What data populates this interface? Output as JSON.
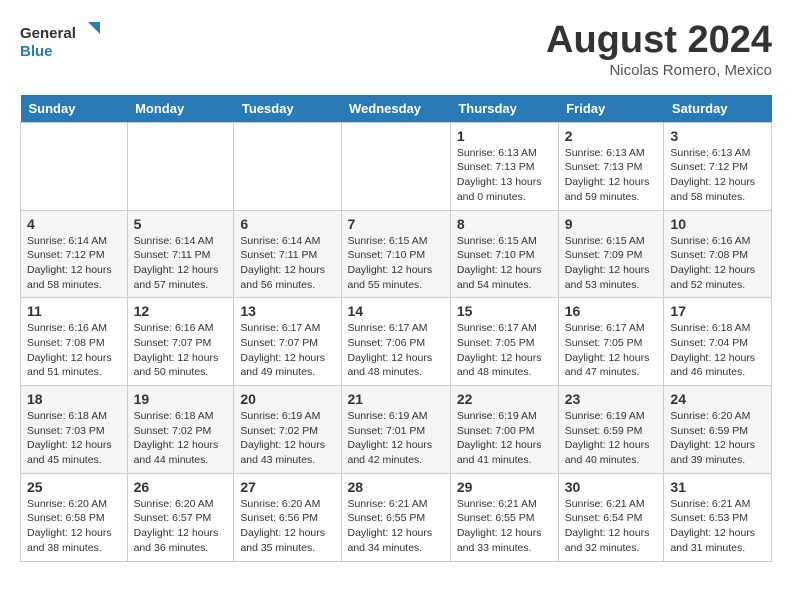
{
  "header": {
    "logo_line1": "General",
    "logo_line2": "Blue",
    "month": "August 2024",
    "location": "Nicolas Romero, Mexico"
  },
  "weekdays": [
    "Sunday",
    "Monday",
    "Tuesday",
    "Wednesday",
    "Thursday",
    "Friday",
    "Saturday"
  ],
  "weeks": [
    [
      {
        "day": "",
        "sunrise": "",
        "sunset": "",
        "daylight": ""
      },
      {
        "day": "",
        "sunrise": "",
        "sunset": "",
        "daylight": ""
      },
      {
        "day": "",
        "sunrise": "",
        "sunset": "",
        "daylight": ""
      },
      {
        "day": "",
        "sunrise": "",
        "sunset": "",
        "daylight": ""
      },
      {
        "day": "1",
        "sunrise": "Sunrise: 6:13 AM",
        "sunset": "Sunset: 7:13 PM",
        "daylight": "Daylight: 13 hours and 0 minutes."
      },
      {
        "day": "2",
        "sunrise": "Sunrise: 6:13 AM",
        "sunset": "Sunset: 7:13 PM",
        "daylight": "Daylight: 12 hours and 59 minutes."
      },
      {
        "day": "3",
        "sunrise": "Sunrise: 6:13 AM",
        "sunset": "Sunset: 7:12 PM",
        "daylight": "Daylight: 12 hours and 58 minutes."
      }
    ],
    [
      {
        "day": "4",
        "sunrise": "Sunrise: 6:14 AM",
        "sunset": "Sunset: 7:12 PM",
        "daylight": "Daylight: 12 hours and 58 minutes."
      },
      {
        "day": "5",
        "sunrise": "Sunrise: 6:14 AM",
        "sunset": "Sunset: 7:11 PM",
        "daylight": "Daylight: 12 hours and 57 minutes."
      },
      {
        "day": "6",
        "sunrise": "Sunrise: 6:14 AM",
        "sunset": "Sunset: 7:11 PM",
        "daylight": "Daylight: 12 hours and 56 minutes."
      },
      {
        "day": "7",
        "sunrise": "Sunrise: 6:15 AM",
        "sunset": "Sunset: 7:10 PM",
        "daylight": "Daylight: 12 hours and 55 minutes."
      },
      {
        "day": "8",
        "sunrise": "Sunrise: 6:15 AM",
        "sunset": "Sunset: 7:10 PM",
        "daylight": "Daylight: 12 hours and 54 minutes."
      },
      {
        "day": "9",
        "sunrise": "Sunrise: 6:15 AM",
        "sunset": "Sunset: 7:09 PM",
        "daylight": "Daylight: 12 hours and 53 minutes."
      },
      {
        "day": "10",
        "sunrise": "Sunrise: 6:16 AM",
        "sunset": "Sunset: 7:08 PM",
        "daylight": "Daylight: 12 hours and 52 minutes."
      }
    ],
    [
      {
        "day": "11",
        "sunrise": "Sunrise: 6:16 AM",
        "sunset": "Sunset: 7:08 PM",
        "daylight": "Daylight: 12 hours and 51 minutes."
      },
      {
        "day": "12",
        "sunrise": "Sunrise: 6:16 AM",
        "sunset": "Sunset: 7:07 PM",
        "daylight": "Daylight: 12 hours and 50 minutes."
      },
      {
        "day": "13",
        "sunrise": "Sunrise: 6:17 AM",
        "sunset": "Sunset: 7:07 PM",
        "daylight": "Daylight: 12 hours and 49 minutes."
      },
      {
        "day": "14",
        "sunrise": "Sunrise: 6:17 AM",
        "sunset": "Sunset: 7:06 PM",
        "daylight": "Daylight: 12 hours and 48 minutes."
      },
      {
        "day": "15",
        "sunrise": "Sunrise: 6:17 AM",
        "sunset": "Sunset: 7:05 PM",
        "daylight": "Daylight: 12 hours and 48 minutes."
      },
      {
        "day": "16",
        "sunrise": "Sunrise: 6:17 AM",
        "sunset": "Sunset: 7:05 PM",
        "daylight": "Daylight: 12 hours and 47 minutes."
      },
      {
        "day": "17",
        "sunrise": "Sunrise: 6:18 AM",
        "sunset": "Sunset: 7:04 PM",
        "daylight": "Daylight: 12 hours and 46 minutes."
      }
    ],
    [
      {
        "day": "18",
        "sunrise": "Sunrise: 6:18 AM",
        "sunset": "Sunset: 7:03 PM",
        "daylight": "Daylight: 12 hours and 45 minutes."
      },
      {
        "day": "19",
        "sunrise": "Sunrise: 6:18 AM",
        "sunset": "Sunset: 7:02 PM",
        "daylight": "Daylight: 12 hours and 44 minutes."
      },
      {
        "day": "20",
        "sunrise": "Sunrise: 6:19 AM",
        "sunset": "Sunset: 7:02 PM",
        "daylight": "Daylight: 12 hours and 43 minutes."
      },
      {
        "day": "21",
        "sunrise": "Sunrise: 6:19 AM",
        "sunset": "Sunset: 7:01 PM",
        "daylight": "Daylight: 12 hours and 42 minutes."
      },
      {
        "day": "22",
        "sunrise": "Sunrise: 6:19 AM",
        "sunset": "Sunset: 7:00 PM",
        "daylight": "Daylight: 12 hours and 41 minutes."
      },
      {
        "day": "23",
        "sunrise": "Sunrise: 6:19 AM",
        "sunset": "Sunset: 6:59 PM",
        "daylight": "Daylight: 12 hours and 40 minutes."
      },
      {
        "day": "24",
        "sunrise": "Sunrise: 6:20 AM",
        "sunset": "Sunset: 6:59 PM",
        "daylight": "Daylight: 12 hours and 39 minutes."
      }
    ],
    [
      {
        "day": "25",
        "sunrise": "Sunrise: 6:20 AM",
        "sunset": "Sunset: 6:58 PM",
        "daylight": "Daylight: 12 hours and 38 minutes."
      },
      {
        "day": "26",
        "sunrise": "Sunrise: 6:20 AM",
        "sunset": "Sunset: 6:57 PM",
        "daylight": "Daylight: 12 hours and 36 minutes."
      },
      {
        "day": "27",
        "sunrise": "Sunrise: 6:20 AM",
        "sunset": "Sunset: 6:56 PM",
        "daylight": "Daylight: 12 hours and 35 minutes."
      },
      {
        "day": "28",
        "sunrise": "Sunrise: 6:21 AM",
        "sunset": "Sunset: 6:55 PM",
        "daylight": "Daylight: 12 hours and 34 minutes."
      },
      {
        "day": "29",
        "sunrise": "Sunrise: 6:21 AM",
        "sunset": "Sunset: 6:55 PM",
        "daylight": "Daylight: 12 hours and 33 minutes."
      },
      {
        "day": "30",
        "sunrise": "Sunrise: 6:21 AM",
        "sunset": "Sunset: 6:54 PM",
        "daylight": "Daylight: 12 hours and 32 minutes."
      },
      {
        "day": "31",
        "sunrise": "Sunrise: 6:21 AM",
        "sunset": "Sunset: 6:53 PM",
        "daylight": "Daylight: 12 hours and 31 minutes."
      }
    ]
  ]
}
